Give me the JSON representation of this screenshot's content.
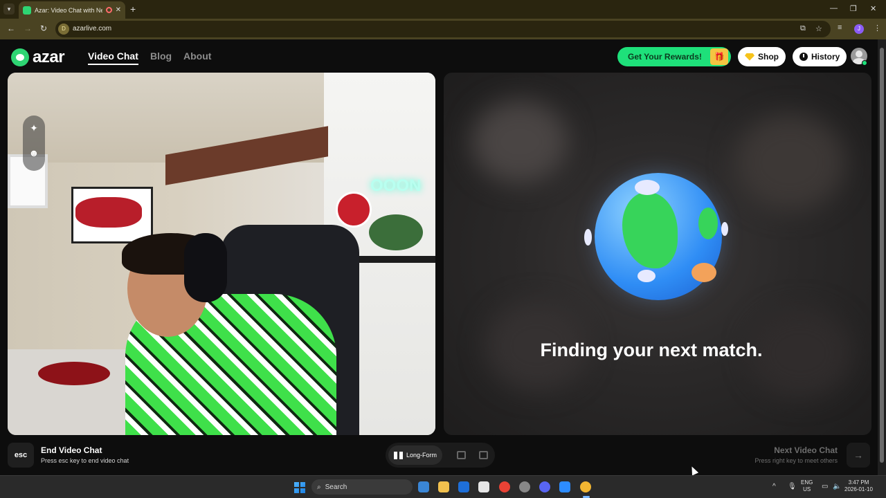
{
  "browser": {
    "tab_title": "Azar: Video Chat with New",
    "tab_close": "✕",
    "new_tab": "+",
    "url": "azarlive.com",
    "site_badge": "D",
    "profile_initial": "J",
    "window_controls": [
      "—",
      "❐",
      "✕"
    ],
    "nav_icons": [
      "back-icon",
      "forward-icon",
      "reload-icon"
    ]
  },
  "header": {
    "logo": "azar",
    "nav": {
      "video_chat": "Video Chat",
      "blog": "Blog",
      "about": "About"
    },
    "rewards_label": "Get Your Rewards!",
    "shop_label": "Shop",
    "history_label": "History"
  },
  "main": {
    "finding_text": "Finding your next match."
  },
  "footer": {
    "esc_key": "esc",
    "end_title": "End Video Chat",
    "end_sub": "Press esc key to end video chat",
    "mode_label": "Long-Form",
    "next_title": "Next Video Chat",
    "next_sub": "Press right key to meet others",
    "next_arrow": "→"
  },
  "taskbar": {
    "search_placeholder": "Search",
    "lang_line1": "ENG",
    "lang_line2": "US",
    "time": "3:47 PM",
    "date": "2026-01-10"
  },
  "colors": {
    "accent_green": "#1ee07a",
    "chrome_bg": "#2a250f",
    "panel_bg": "#0d0d0d"
  }
}
